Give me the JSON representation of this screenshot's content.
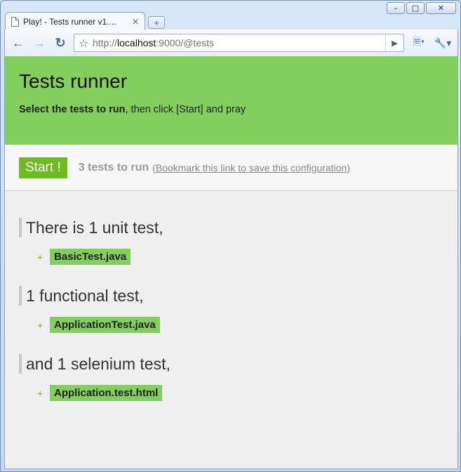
{
  "browser": {
    "tab_title": "Play! - Tests runner v1....",
    "url_prefix": "http://",
    "url_host": "localhost",
    "url_rest": ":9000/@tests"
  },
  "icons": [
    "page-icon",
    "close-icon",
    "new-tab-icon",
    "back-icon",
    "forward-icon",
    "reload-icon",
    "star-icon",
    "go-icon",
    "page-menu-icon",
    "wrench-icon"
  ],
  "header": {
    "title": "Tests runner",
    "subtitle_bold": "Select the tests to run",
    "subtitle_rest": ", then click [Start] and pray"
  },
  "runbar": {
    "start_label": "Start !",
    "count_text": "3 tests to run",
    "paren_open": "(",
    "bookmark_link": "Bookmark this link to save this configuration",
    "paren_close": ")"
  },
  "groups": [
    {
      "heading": "There is 1 unit test,",
      "files": [
        "BasicTest.java"
      ]
    },
    {
      "heading": "1 functional test,",
      "files": [
        "ApplicationTest.java"
      ]
    },
    {
      "heading": "and 1 selenium test,",
      "files": [
        "Application.test.html"
      ]
    }
  ],
  "colors": {
    "header_bg": "#82cf5d",
    "start_bg": "#6dbb1e",
    "page_bg": "#efefef"
  }
}
